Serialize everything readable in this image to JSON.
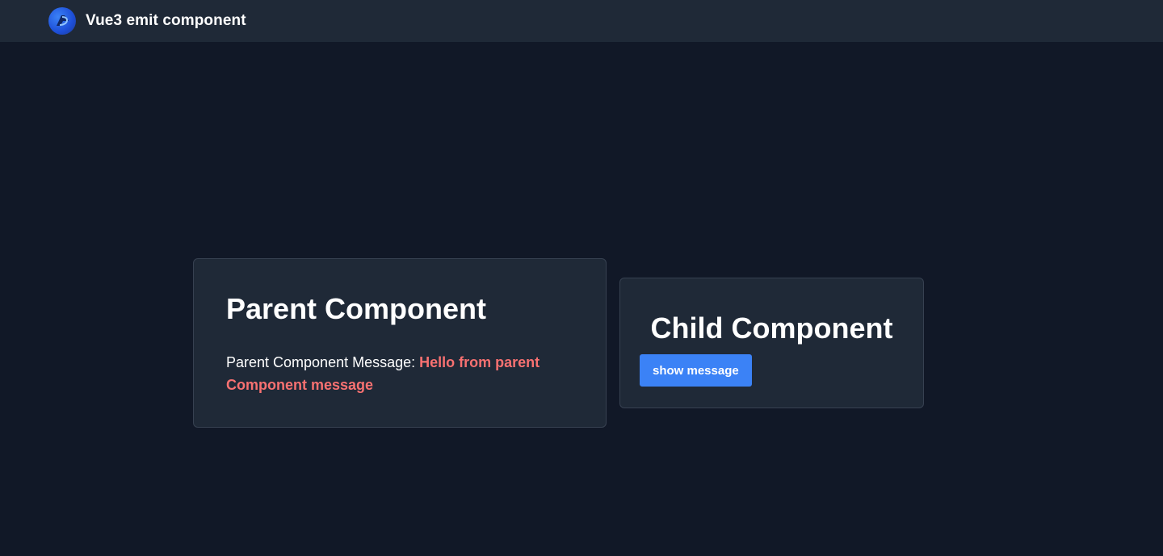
{
  "navbar": {
    "title": "Vue3 emit component",
    "logo_icon": "vue-logo-icon"
  },
  "parent": {
    "title": "Parent Component",
    "message_label": "Parent Component Message: ",
    "message_value": "Hello from parent Component message"
  },
  "child": {
    "title": "Child Component",
    "button_label": "show message"
  },
  "colors": {
    "background": "#111827",
    "surface": "#1f2937",
    "accent": "#3b82f6",
    "message": "#f87171"
  }
}
